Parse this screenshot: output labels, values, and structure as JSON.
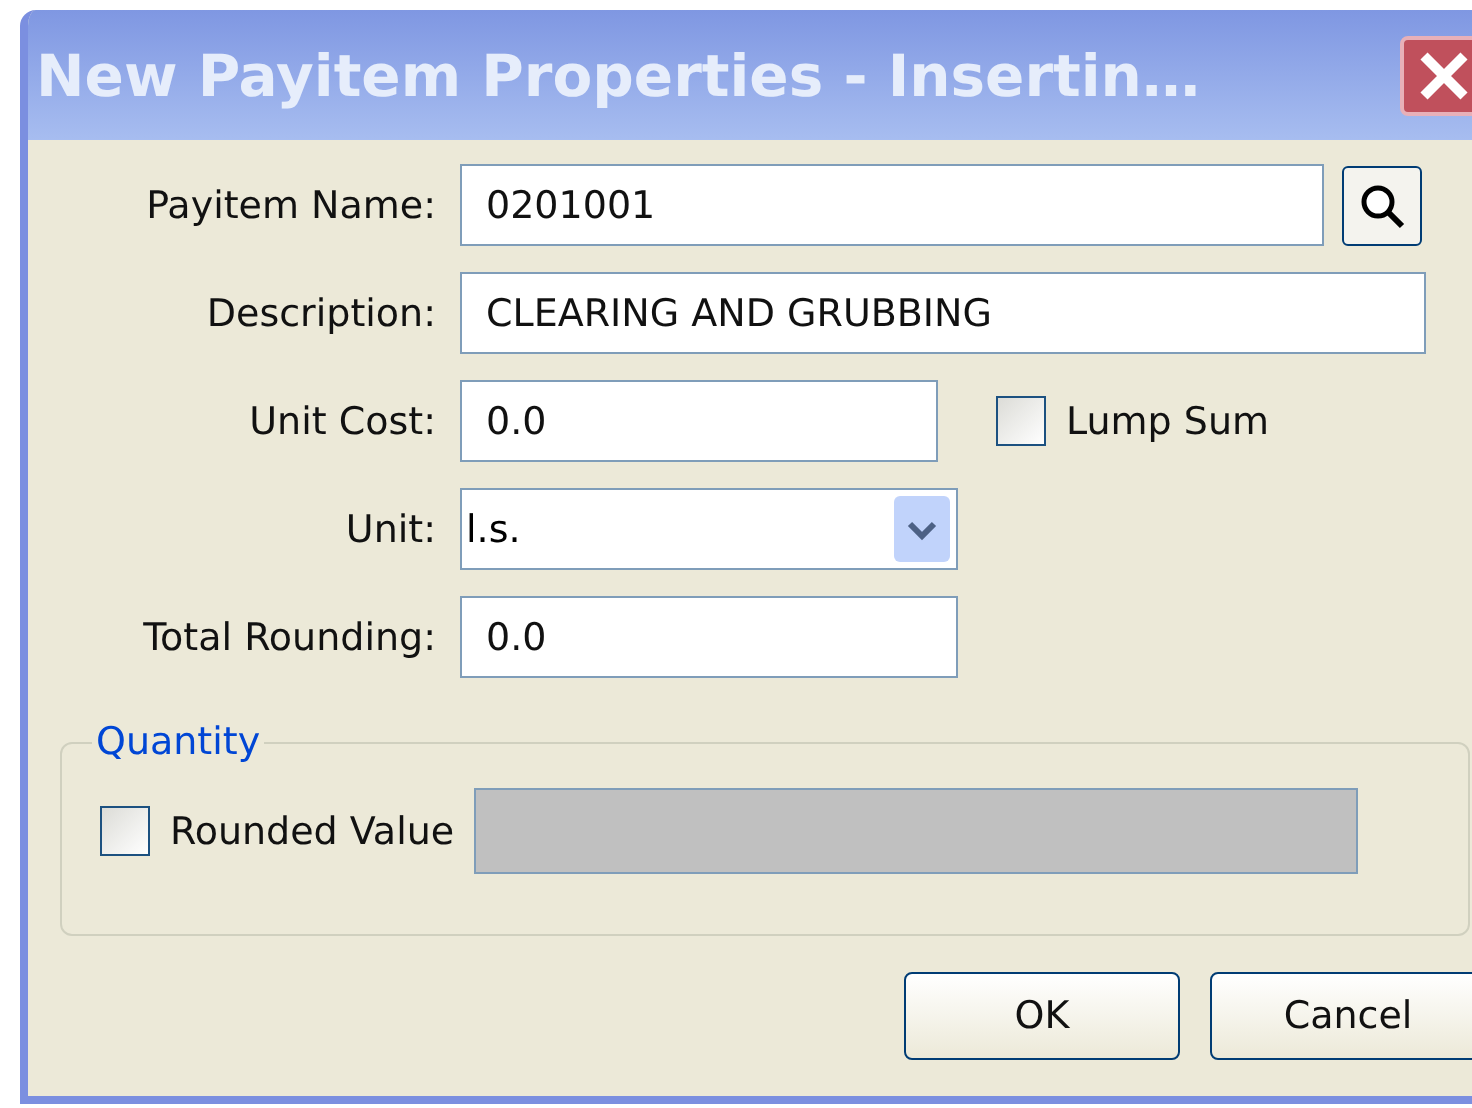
{
  "window": {
    "title": "New Payitem Properties - Insertin…"
  },
  "fields": [
    {
      "kind": "search",
      "label": "Payitem Name:",
      "value": "0201001"
    },
    {
      "kind": "text",
      "label": "Description:",
      "value": "CLEARING AND GRUBBING"
    },
    {
      "kind": "checkbox-text",
      "label": "Unit Cost:",
      "value": "0.0",
      "checkbox": {
        "label": "Lump Sum",
        "checked": false
      }
    },
    {
      "kind": "combo",
      "label": "Unit:",
      "value": "l.s."
    },
    {
      "kind": "short",
      "label": "Total Rounding:",
      "value": "0.0"
    }
  ],
  "quantity": {
    "legend": "Quantity",
    "rounded": {
      "label": "Rounded Value",
      "checked": false
    }
  },
  "buttons": [
    "OK",
    "Cancel"
  ]
}
